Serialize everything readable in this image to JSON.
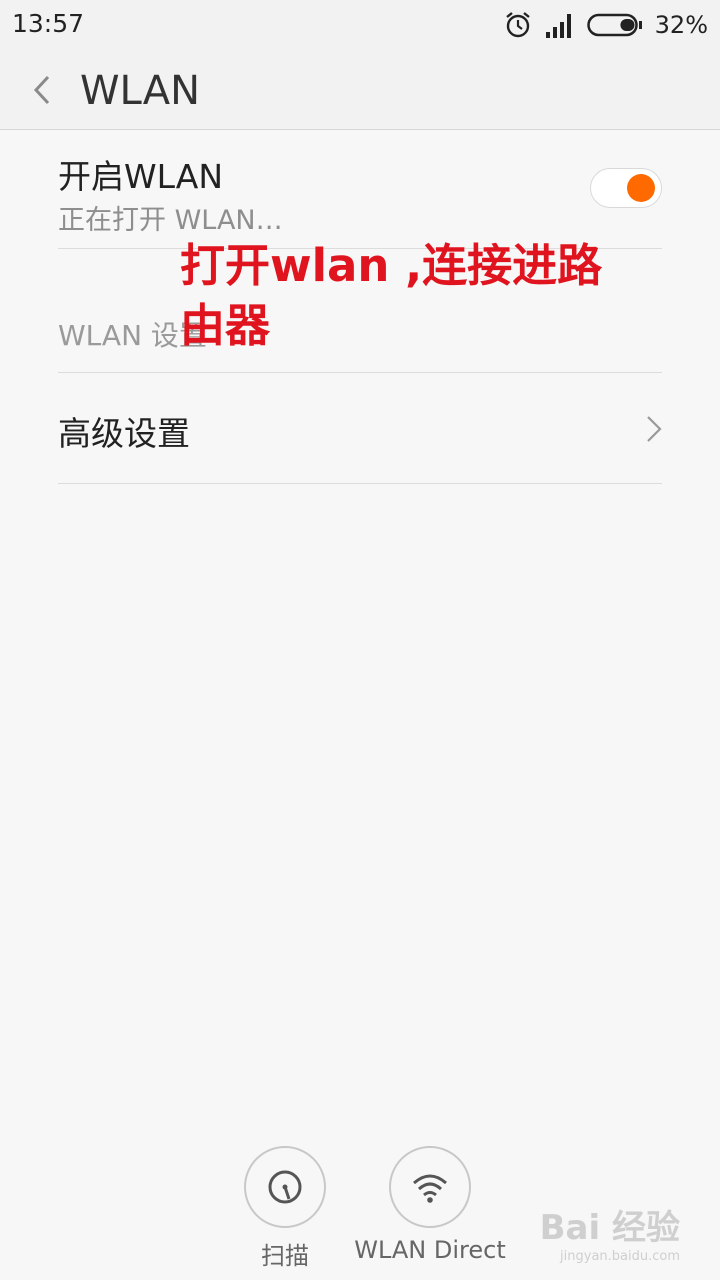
{
  "status_bar": {
    "time": "13:57",
    "battery_percent": "32%",
    "battery_level": 0.32,
    "icons": [
      "alarm-icon",
      "signal-icon",
      "battery-icon"
    ]
  },
  "header": {
    "title": "WLAN"
  },
  "wlan_toggle": {
    "title": "开启WLAN",
    "subtitle": "正在打开 WLAN…",
    "on": true,
    "accent_color": "#ff6a00"
  },
  "section": {
    "label": "WLAN 设置"
  },
  "advanced": {
    "label": "高级设置"
  },
  "annotation": {
    "line1": "打开wlan ,连接进路",
    "line2": "由器",
    "color": "#e0141e"
  },
  "bottom_actions": [
    {
      "label": "扫描",
      "icon": "scan-icon"
    },
    {
      "label": "WLAN Direct",
      "icon": "wifi-icon"
    }
  ],
  "watermark": {
    "main": "Bai 经验",
    "sub": "jingyan.baidu.com"
  }
}
